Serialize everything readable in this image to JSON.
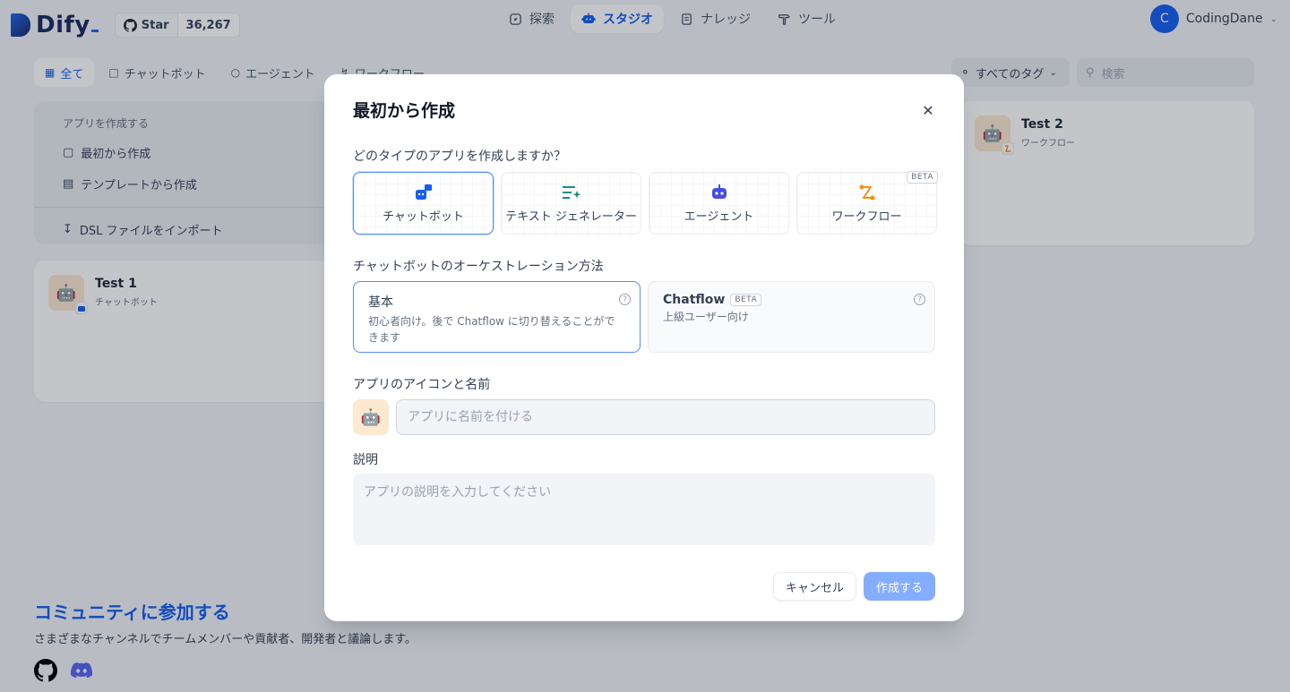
{
  "app": {
    "logo": "Dify",
    "github": {
      "star_label": "Star",
      "count": "36,267"
    },
    "nav": [
      {
        "label": "探索",
        "icon": "compass-icon"
      },
      {
        "label": "スタジオ",
        "icon": "robot-icon",
        "active": true
      },
      {
        "label": "ナレッジ",
        "icon": "book-icon"
      },
      {
        "label": "ツール",
        "icon": "hammer-icon"
      }
    ],
    "user": {
      "initial": "C",
      "name": "CodingDane"
    }
  },
  "filters": {
    "tabs": [
      {
        "label": "全て",
        "active": true
      },
      {
        "label": "チャットボット"
      },
      {
        "label": "エージェント"
      },
      {
        "label": "ワークフロー"
      }
    ],
    "tags_label": "すべてのタグ",
    "search_placeholder": "検索"
  },
  "create_card": {
    "title": "アプリを作成する",
    "items": [
      "最初から作成",
      "テンプレートから作成"
    ],
    "import": "DSL ファイルをインポート"
  },
  "apps": [
    {
      "name": "Test 1",
      "type": "チャットボット"
    },
    {
      "name": "Test 2",
      "type": "ワークフロー"
    }
  ],
  "community": {
    "title": "コミュニティに参加する",
    "subtitle": "さまざまなチャンネルでチームメンバーや貢献者、開発者と議論します。"
  },
  "modal": {
    "title": "最初から作成",
    "type_question": "どのタイプのアプリを作成しますか？",
    "types": [
      {
        "label": "チャットボット",
        "icon": "chatbot-icon",
        "selected": true
      },
      {
        "label": "テキスト ジェネレーター",
        "icon": "text-generator-icon"
      },
      {
        "label": "エージェント",
        "icon": "agent-icon"
      },
      {
        "label": "ワークフロー",
        "icon": "workflow-icon",
        "badge": "BETA"
      }
    ],
    "orchestration_label": "チャットボットのオーケストレーション方法",
    "orchestration": [
      {
        "title": "基本",
        "desc": "初心者向け。後で Chatflow に切り替えることができます",
        "selected": true
      },
      {
        "title": "Chatflow",
        "badge": "BETA",
        "desc": "上級ユーザー向け"
      }
    ],
    "icon_name_label": "アプリのアイコンと名前",
    "name_placeholder": "アプリに名前を付ける",
    "desc_label": "説明",
    "desc_placeholder": "アプリの説明を入力してください",
    "cancel": "キャンセル",
    "create": "作成する"
  },
  "colors": {
    "accent": "#155eef",
    "create_disabled": "#84adff",
    "overlay": "rgba(16,24,40,0.25)"
  }
}
